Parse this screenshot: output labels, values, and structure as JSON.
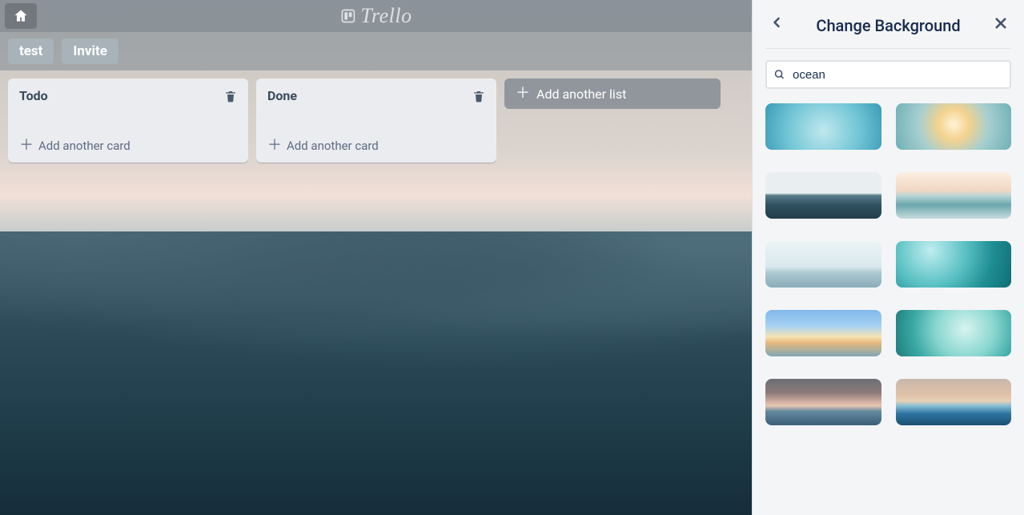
{
  "brand": {
    "name": "Trello"
  },
  "board": {
    "name": "test",
    "invite_label": "Invite",
    "add_list_label": "Add another list",
    "lists": [
      {
        "title": "Todo",
        "add_card_label": "Add another card"
      },
      {
        "title": "Done",
        "add_card_label": "Add another card"
      }
    ]
  },
  "sidepanel": {
    "title": "Change Background",
    "search_value": "ocean",
    "thumb_count": 10
  }
}
